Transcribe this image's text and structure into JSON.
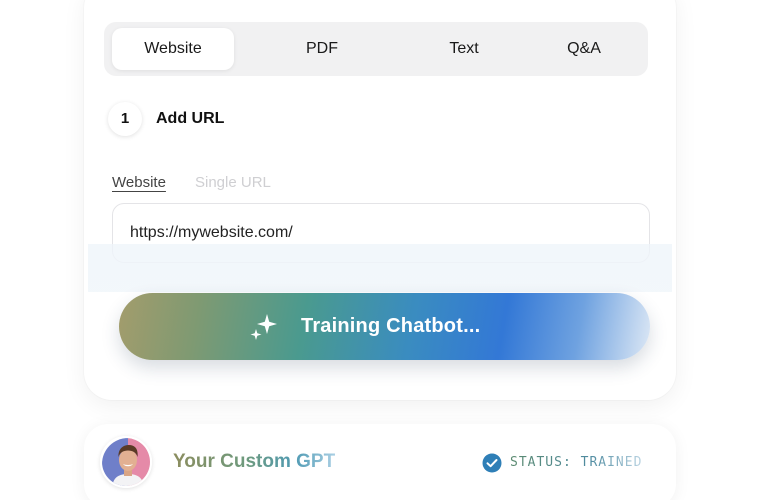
{
  "tabs": [
    {
      "label": "Website",
      "active": true
    },
    {
      "label": "PDF",
      "active": false
    },
    {
      "label": "Text",
      "active": false
    },
    {
      "label": "Q&A",
      "active": false
    }
  ],
  "step": {
    "number": "1",
    "label": "Add URL"
  },
  "source_tabs": [
    {
      "label": "Website",
      "active": true
    },
    {
      "label": "Single URL",
      "active": false
    }
  ],
  "url_input": {
    "value": "https://mywebsite.com/"
  },
  "train_button": {
    "label": "Training Chatbot...",
    "icon": "sparkle-icon"
  },
  "bottom": {
    "title": "Your Custom GPT",
    "status": "STATUS: TRAINED",
    "status_icon": "check-circle-icon"
  },
  "colors": {
    "button_gradient_start": "#a39c6c",
    "button_gradient_mid": "#3378d6",
    "status_check": "#2f7fb7"
  }
}
